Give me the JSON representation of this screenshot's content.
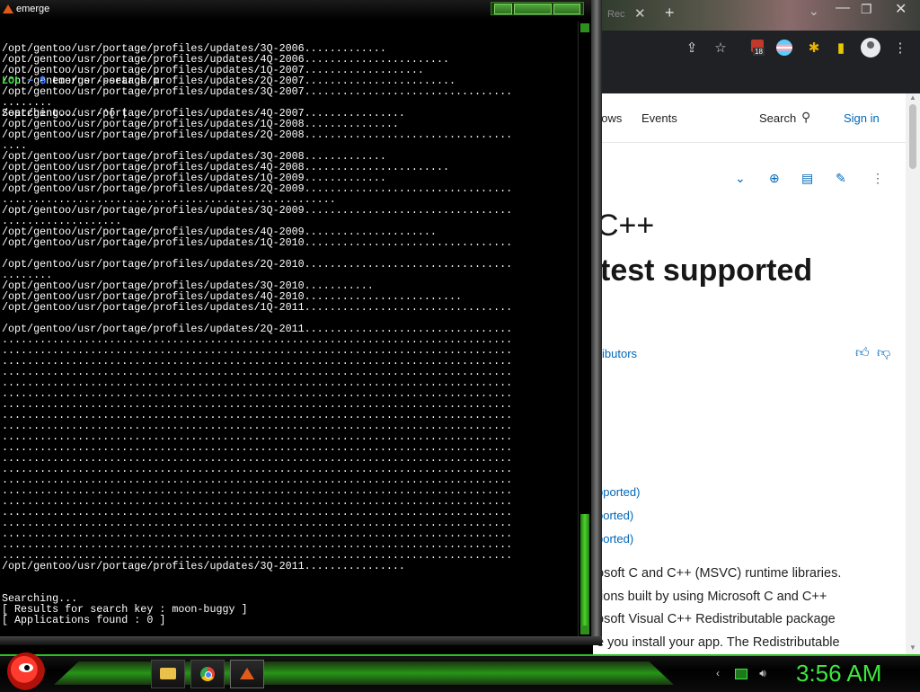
{
  "terminal": {
    "title": "emerge",
    "lines": [
      "/opt/gentoo/usr/portage/profiles/updates/3Q-2006.............",
      "/opt/gentoo/usr/portage/profiles/updates/4Q-2006.......................",
      "/opt/gentoo/usr/portage/profiles/updates/1Q-2007...................",
      "/opt/gentoo/usr/portage/profiles/updates/2Q-2007........................",
      "/opt/gentoo/usr/portage/profiles/updates/3Q-2007.................................",
      "........",
      "/opt/gentoo/usr/portage/profiles/updates/4Q-2007................",
      "/opt/gentoo/usr/portage/profiles/updates/1Q-2008...............",
      "/opt/gentoo/usr/portage/profiles/updates/2Q-2008.................................",
      "....",
      "/opt/gentoo/usr/portage/profiles/updates/3Q-2008.............",
      "/opt/gentoo/usr/portage/profiles/updates/4Q-2008.......................",
      "/opt/gentoo/usr/portage/profiles/updates/1Q-2009.............",
      "/opt/gentoo/usr/portage/profiles/updates/2Q-2009.................................",
      ".....................................................",
      "/opt/gentoo/usr/portage/profiles/updates/3Q-2009.................................",
      "...................",
      "/opt/gentoo/usr/portage/profiles/updates/4Q-2009.....................",
      "/opt/gentoo/usr/portage/profiles/updates/1Q-2010.................................",
      "",
      "/opt/gentoo/usr/portage/profiles/updates/2Q-2010.................................",
      "........",
      "/opt/gentoo/usr/portage/profiles/updates/3Q-2010...........",
      "/opt/gentoo/usr/portage/profiles/updates/4Q-2010.........................",
      "/opt/gentoo/usr/portage/profiles/updates/1Q-2011.................................",
      "",
      "/opt/gentoo/usr/portage/profiles/updates/2Q-2011.................................",
      ".................................................................................",
      ".................................................................................",
      ".................................................................................",
      ".................................................................................",
      ".................................................................................",
      ".................................................................................",
      ".................................................................................",
      ".................................................................................",
      ".................................................................................",
      ".................................................................................",
      ".................................................................................",
      ".................................................................................",
      ".................................................................................",
      ".................................................................................",
      ".................................................................................",
      ".................................................................................",
      ".................................................................................",
      ".................................................................................",
      ".................................................................................",
      ".................................................................................",
      ".................................................................................",
      "/opt/gentoo/usr/portage/profiles/updates/3Q-2011................",
      "",
      "",
      "Searching...",
      "[ Results for search key : moon-buggy ]",
      "[ Applications found : 0 ]",
      ""
    ],
    "prompt": {
      "user": "LOL",
      "dir": "~",
      "symbol": "$",
      "command": "emerge --search m"
    },
    "last_line": "Searching...   -^[ |"
  },
  "browser": {
    "tab_fragment": "Rec",
    "nav": [
      "hows",
      "Events"
    ],
    "search_label": "Search",
    "signin_label": "Sign in",
    "extension_badge": "18",
    "title_line1": "C++",
    "title_line2": "test supported",
    "contributors": "ibutors",
    "toc": [
      "pported)",
      "ported)",
      "ported)"
    ],
    "body": [
      "osoft C and C++ (MSVC) runtime libraries.",
      "tions built by using Microsoft C and C++",
      "osoft Visual C++ Redistributable package",
      "e you install your app. The Redistributable"
    ]
  },
  "taskbar": {
    "clock": "3:56 AM"
  },
  "colors": {
    "accent_green": "#3ce83c",
    "link_blue": "#0067b8",
    "prompt_user": "#3cdc3c",
    "prompt_symbol": "#3c7cff"
  }
}
